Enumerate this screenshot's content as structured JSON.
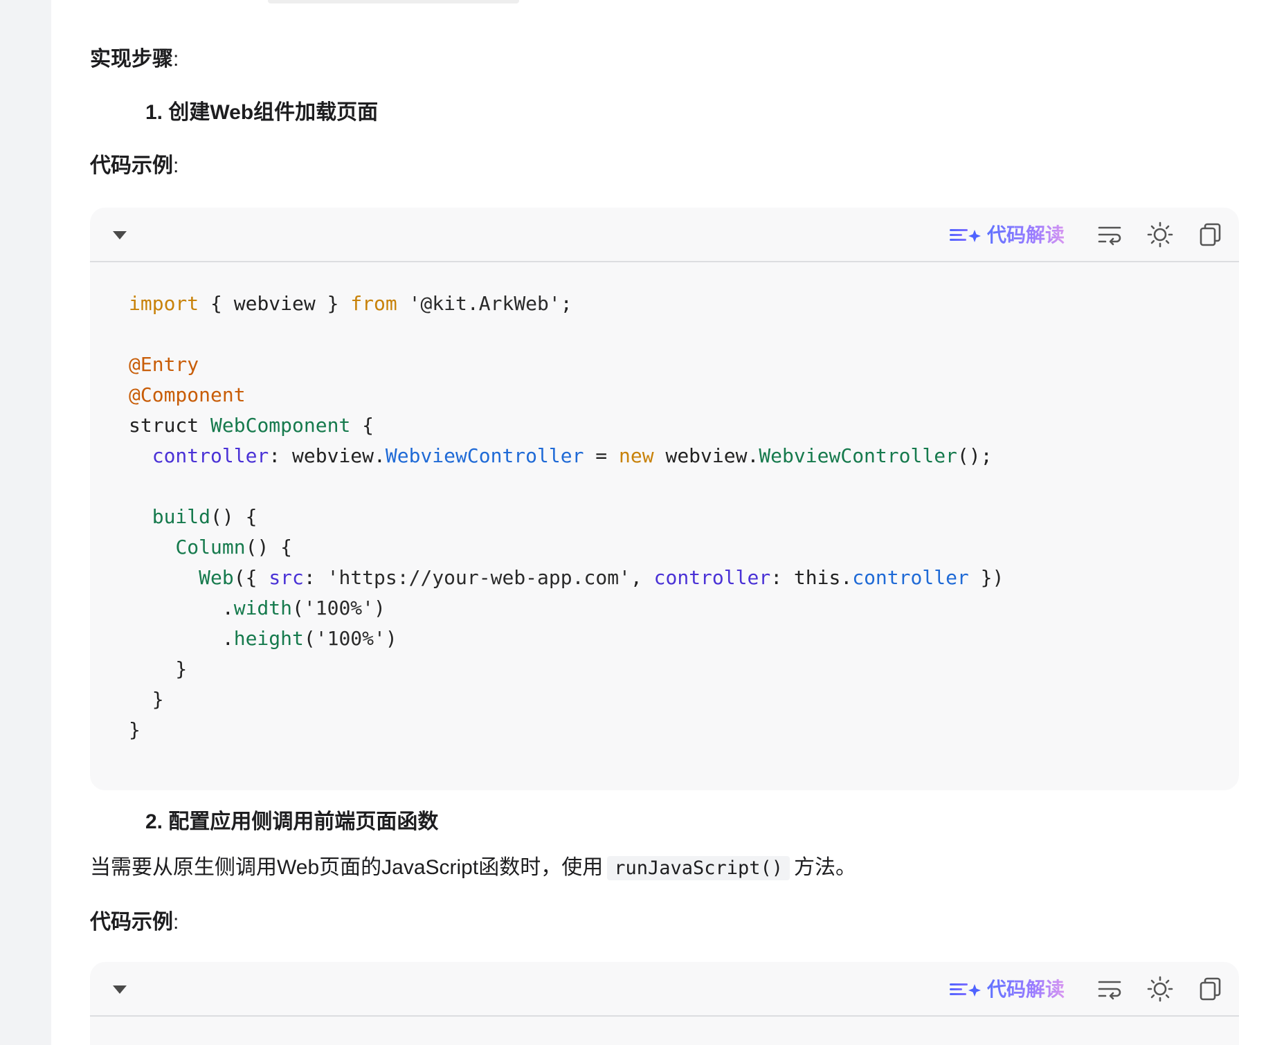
{
  "labels": {
    "steps": "实现步骤",
    "code_example": "代码示例",
    "colon": ":"
  },
  "steps": [
    {
      "number": "1.",
      "title": "创建Web组件加载页面"
    },
    {
      "number": "2.",
      "title": "配置应用侧调用前端页面函数"
    }
  ],
  "paragraph2": {
    "before": "当需要从原生侧调用Web页面的JavaScript函数时，使用",
    "code": "runJavaScript()",
    "after": "方法。"
  },
  "toolbar": {
    "interpret_label": "代码解读",
    "icons": [
      "collapse-caret-icon",
      "sparkle-lines-icon",
      "wrap-text-icon",
      "sun-theme-icon",
      "copy-icon"
    ]
  },
  "colors": {
    "keyword": "#c8820a",
    "decorator": "#c85d08",
    "function": "#167a4d",
    "property": "#4a32d6",
    "type": "#1f6ad6",
    "interpret_gradient_start": "#5f73ff",
    "interpret_gradient_end": "#d796f0"
  },
  "code1": {
    "language": "ArkTS",
    "lines": [
      "import { webview } from '@kit.ArkWeb';",
      "",
      "@Entry",
      "@Component",
      "struct WebComponent {",
      "  controller: webview.WebviewController = new webview.WebviewController();",
      "",
      "  build() {",
      "    Column() {",
      "      Web({ src: 'https://your-web-app.com', controller: this.controller })",
      "        .width('100%')",
      "        .height('100%')",
      "    }",
      "  }",
      "}"
    ]
  }
}
